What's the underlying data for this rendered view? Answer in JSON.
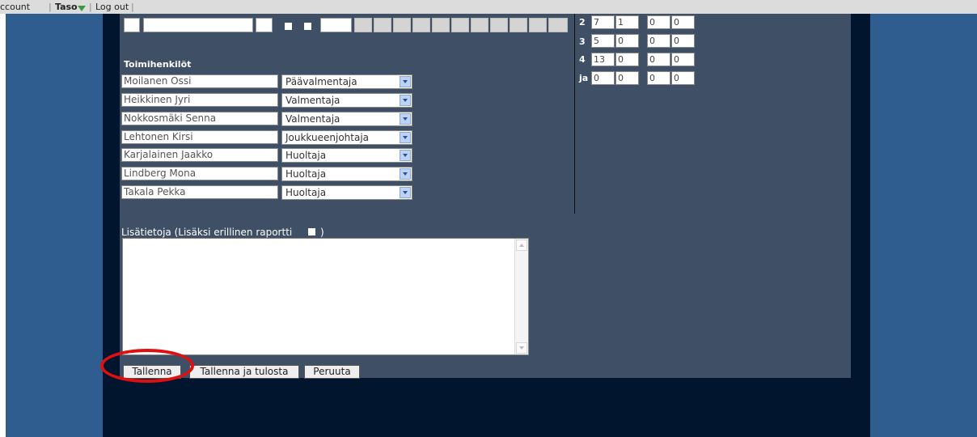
{
  "topbar": {
    "account": "ccount",
    "taso": "Taso",
    "logout": "Log out"
  },
  "staff": {
    "title": "Toimihenkilöt",
    "rows": [
      {
        "name": "Moilanen Ossi",
        "role": "Päävalmentaja"
      },
      {
        "name": "Heikkinen Jyri",
        "role": "Valmentaja"
      },
      {
        "name": "Nokkosmäki Senna",
        "role": "Valmentaja"
      },
      {
        "name": "Lehtonen Kirsi",
        "role": "Joukkueenjohtaja"
      },
      {
        "name": "Karjalainen Jaakko",
        "role": "Huoltaja"
      },
      {
        "name": "Lindberg Mona",
        "role": "Huoltaja"
      },
      {
        "name": "Takala Pekka",
        "role": "Huoltaja"
      }
    ]
  },
  "periods": [
    {
      "label": "2",
      "values": [
        "7",
        "1",
        "0",
        "0"
      ]
    },
    {
      "label": "3",
      "values": [
        "5",
        "0",
        "0",
        "0"
      ]
    },
    {
      "label": "4",
      "values": [
        "13",
        "0",
        "0",
        "0"
      ]
    },
    {
      "label": "ja",
      "values": [
        "0",
        "0",
        "0",
        "0"
      ]
    }
  ],
  "notes": {
    "label": "Lisätietoja (Lisäksi erillinen raportti",
    "label_end": ")",
    "value": ""
  },
  "buttons": {
    "save": "Tallenna",
    "save_print": "Tallenna ja tulosta",
    "cancel": "Peruuta"
  },
  "colors": {
    "panel": "#3f4f66",
    "side": "#2f5d8f",
    "dark": "#02152e",
    "highlight": "#e01010"
  }
}
